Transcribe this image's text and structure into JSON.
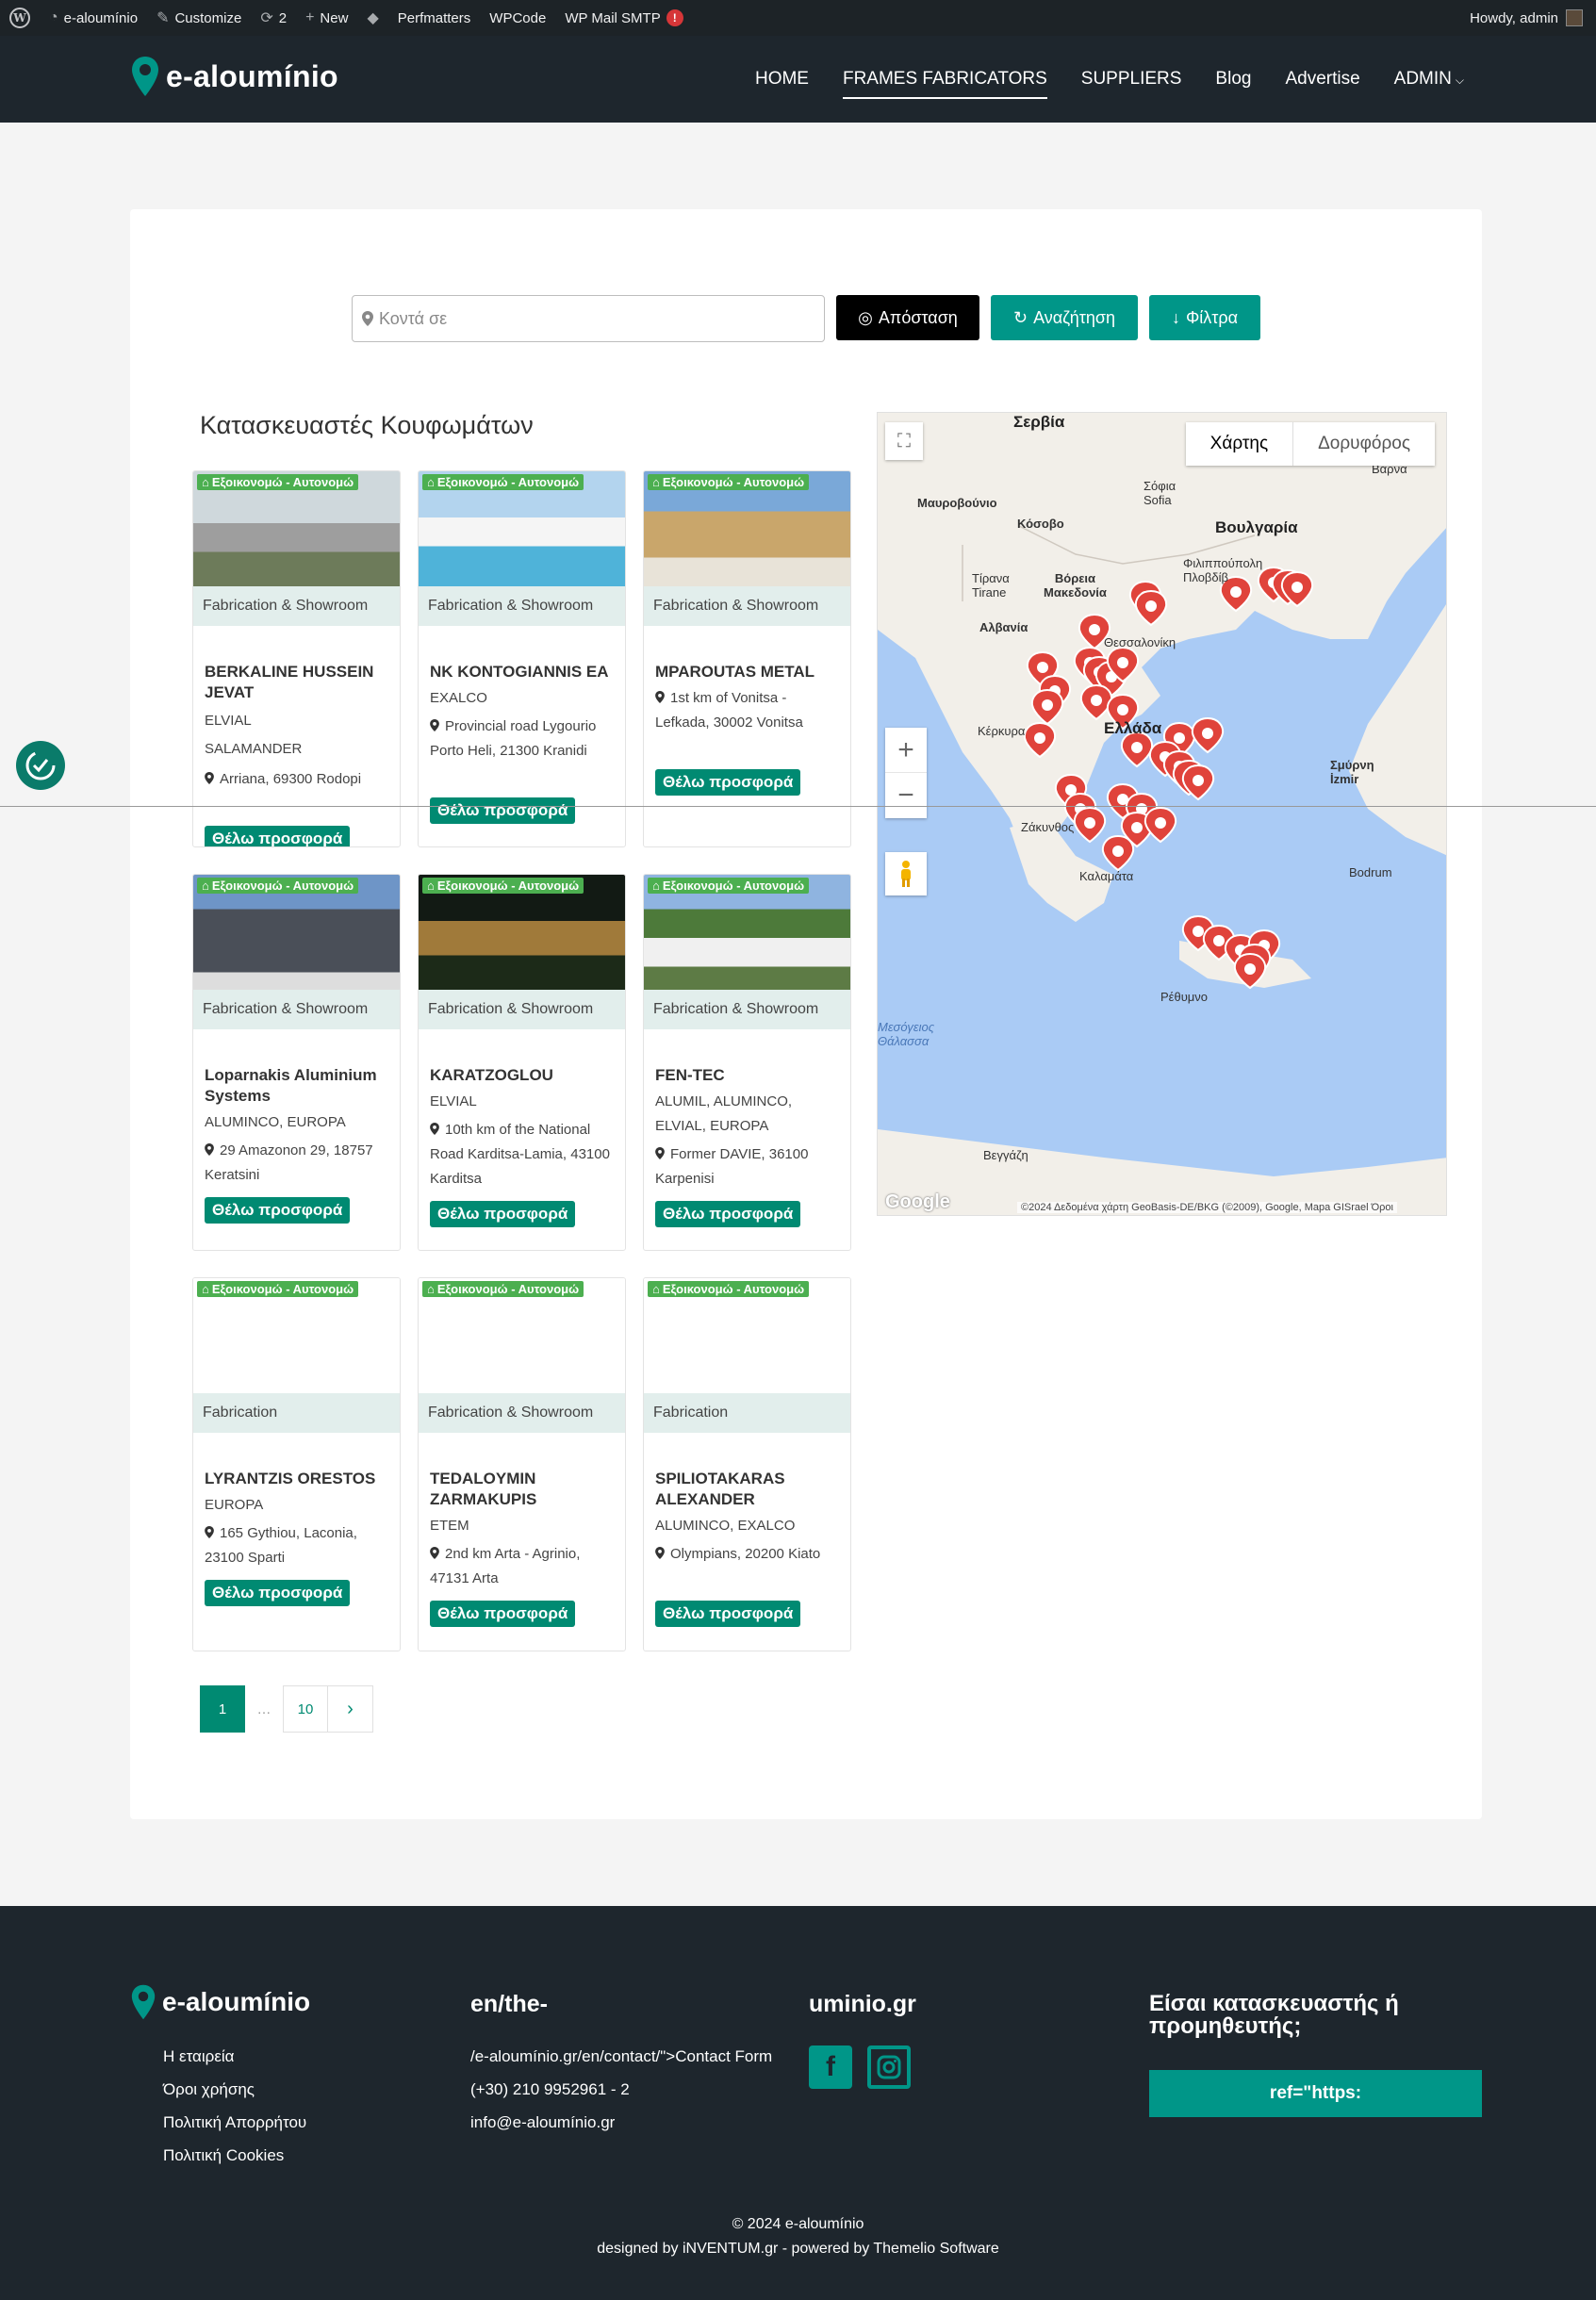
{
  "adminbar": {
    "site_name": "e-aloumínio",
    "customize": "Customize",
    "updates_count": "2",
    "new_label": "New",
    "perfmatters": "Perfmatters",
    "wpcode": "WPCode",
    "smtp": "WP Mail SMTP",
    "smtp_badge": "!",
    "howdy": "Howdy, admin"
  },
  "header": {
    "logo_text": "e-aloumínio",
    "nav": [
      {
        "label": "HOME"
      },
      {
        "label": "FRAMES FABRICATORS"
      },
      {
        "label": "SUPPLIERS"
      },
      {
        "label": "Blog"
      },
      {
        "label": "Advertise"
      },
      {
        "label": "ADMIN"
      }
    ]
  },
  "search": {
    "placeholder": "Κοντά σε",
    "distance_label": "Απόσταση",
    "search_label": "Αναζήτηση",
    "filters_label": "Φίλτρα"
  },
  "section_title": "Κατασκευαστές Κουφωμάτων",
  "badge_text": "Εξοικονομώ - Αυτονομώ",
  "offer_label": "Θέλω προσφορά",
  "cards": [
    {
      "category": "Fabrication & Showroom",
      "name": "BERKALINE HUSSEIN JEVAT",
      "brands": "ELVIAL\nSALAMANDER",
      "address": "Arriana, 69300 Rodopi",
      "image": "house-grey"
    },
    {
      "category": "Fabrication & Showroom",
      "name": "NK KONTOGIANNIS EA",
      "brands": "EXALCO",
      "address": "Provincial road Lygourio Porto Heli, 21300 Kranidi",
      "image": "pool-villa"
    },
    {
      "category": "Fabrication & Showroom",
      "name": "MPAROUTAS METAL",
      "brands": "",
      "address": "1st km of Vonitsa - Lefkada, 30002 Vonitsa",
      "image": "stone-house"
    },
    {
      "category": "Fabrication & Showroom",
      "name": "Loparnakis Aluminium Systems",
      "brands": "ALUMINCO, EUROPA",
      "address": "29 Amazonon 29, 18757 Keratsini",
      "image": "tower"
    },
    {
      "category": "Fabrication & Showroom",
      "name": "KARATZOGLOU",
      "brands": "ELVIAL",
      "address": "10th km of the National Road Karditsa-Lamia, 43100 Karditsa",
      "image": "night-house"
    },
    {
      "category": "Fabrication & Showroom",
      "name": "FEN-TEC",
      "brands": "ALUMIL, ALUMINCO, ELVIAL, EUROPA",
      "address": "Former DAVIE, 36100 Karpenisi",
      "image": "hotel"
    },
    {
      "category": "Fabrication",
      "name": "LYRANTZIS ORESTOS",
      "brands": "EUROPA",
      "address": "165 Gythiou, Laconia, 23100 Sparti",
      "image": ""
    },
    {
      "category": "Fabrication & Showroom",
      "name": "TEDALOYMIN ZARMAKUPIS",
      "brands": "ETEM",
      "address": "2nd km Arta - Agrinio, 47131 Arta",
      "image": ""
    },
    {
      "category": "Fabrication",
      "name": "SPILIOTAKARAS ALEXANDER",
      "brands": "ALUMINCO, EXALCO",
      "address": "Olympians, 20200 Kiato",
      "image": ""
    }
  ],
  "map": {
    "toggle_map": "Χάρτης",
    "toggle_satellite": "Δορυφόρος",
    "labels": {
      "serbia": "Σερβία",
      "montenegro": "Μαυροβούνιο",
      "kosovo": "Κόσοβο",
      "sofia": "Σόφια\nSofia",
      "bulgaria": "Βουλγαρία",
      "plovdiv": "Φιλιππούπολη\nΠλοβδίβ",
      "albania": "Αλβανία",
      "tirana": "Τίρανα\nTirane",
      "n_macedonia": "Βόρεια\nΜακεδονία",
      "thessaloniki": "Θεσσαλονίκη",
      "greece": "Ελλάδα",
      "izmir": "Σμύρνη\nİzmir",
      "rethymno": "Ρέθυμνο",
      "benghazi": "Βεγγάζη",
      "med_sea": "Μεσόγειος\nΘάλασσα",
      "kerkyra": "Κέρκυρα",
      "zakynthos": "Ζάκυνθος",
      "kalamata": "Καλαμάτα",
      "varna": "Βάρνα",
      "bodrum": "Bodrum"
    },
    "attribution": "©2024 Δεδομένα χάρτη GeoBasis-DE/BKG (©2009), Google, Mapa GISrael   Όροι",
    "google": "Google",
    "marker_color": "#e0433b"
  },
  "pagination": {
    "current": "1",
    "dots": "…",
    "last": "10"
  },
  "footer": {
    "logo_text": "e-aloumínio",
    "links": [
      "Η εταιρεία",
      "Όροι χρήσης",
      "Πολιτική Απορρήτου",
      "Πολιτική Cookies"
    ],
    "col2_head": "en/the-",
    "contact": [
      "/e-aloumínio.gr/en/contact/\">Contact Form",
      "(+30) 210 9952961 - 2",
      "info@e-aloumínio.gr"
    ],
    "col3_head": "uminio.gr",
    "cta_title": "Είσαι κατασκευαστής ή προμηθευτής;",
    "cta_button": "ref=\"https:",
    "copyright": "© 2024 e-aloumínio",
    "credits": "designed by iNVENTUM.gr - powered by Themelio Software"
  },
  "colors": {
    "accent": "#009688",
    "offer": "#008a72",
    "dark": "#1e262d",
    "badge": "#4caf50"
  }
}
